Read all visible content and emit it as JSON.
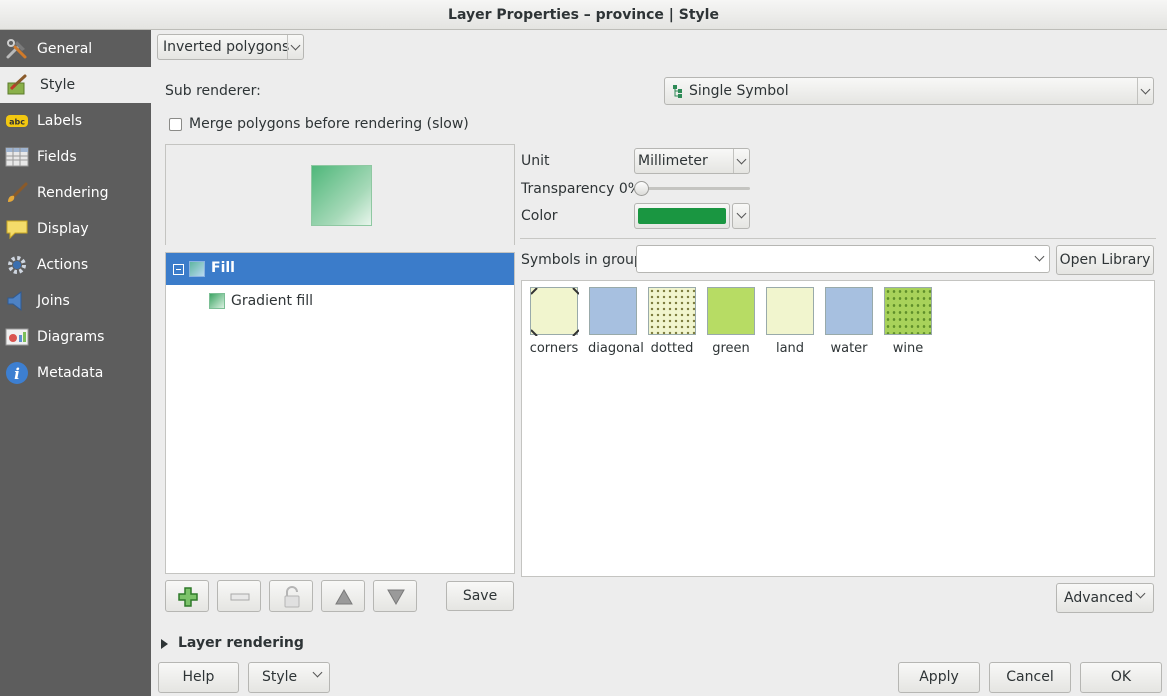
{
  "window": {
    "title": "Layer Properties – province | Style"
  },
  "sidebar": {
    "items": [
      {
        "label": "General",
        "icon": "hammer-wrench-icon"
      },
      {
        "label": "Style",
        "icon": "paintbrush-icon",
        "active": true
      },
      {
        "label": "Labels",
        "icon": "abc-label-icon"
      },
      {
        "label": "Fields",
        "icon": "table-icon"
      },
      {
        "label": "Rendering",
        "icon": "brush-icon"
      },
      {
        "label": "Display",
        "icon": "speech-bubble-icon"
      },
      {
        "label": "Actions",
        "icon": "gear-icon"
      },
      {
        "label": "Joins",
        "icon": "speaker-join-icon"
      },
      {
        "label": "Diagrams",
        "icon": "diagram-icon"
      },
      {
        "label": "Metadata",
        "icon": "info-icon"
      }
    ]
  },
  "renderer": {
    "selected": "Inverted polygons",
    "sub_renderer_label": "Sub renderer:",
    "sub_renderer_value": "Single Symbol",
    "merge_label": "Merge polygons before rendering (slow)",
    "merge_checked": false
  },
  "symbol_tree": {
    "root_label": "Fill",
    "child_label": "Gradient fill"
  },
  "properties": {
    "unit_label": "Unit",
    "unit_value": "Millimeter",
    "transparency_label": "Transparency 0%",
    "transparency": 0,
    "color_label": "Color",
    "color_value": "#1a9641"
  },
  "symbols": {
    "group_label": "Symbols in group",
    "group_value": "",
    "open_library_label": "Open Library",
    "items": [
      {
        "name": "corners"
      },
      {
        "name": "diagonal"
      },
      {
        "name": "dotted"
      },
      {
        "name": "green"
      },
      {
        "name": "land"
      },
      {
        "name": "water"
      },
      {
        "name": "wine"
      }
    ]
  },
  "toolbar": {
    "save_label": "Save",
    "advanced_label": "Advanced"
  },
  "layer_rendering": {
    "label": "Layer rendering"
  },
  "footer": {
    "help": "Help",
    "style": "Style",
    "apply": "Apply",
    "cancel": "Cancel",
    "ok": "OK"
  }
}
